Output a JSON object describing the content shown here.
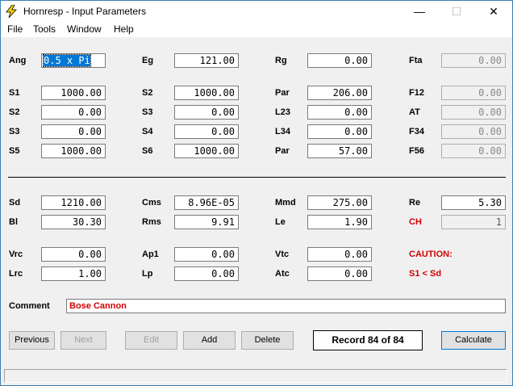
{
  "window": {
    "title": "Hornresp - Input Parameters",
    "minimize": "—",
    "maximize": "☐",
    "close": "✕"
  },
  "menu": {
    "file": "File",
    "tools": "Tools",
    "window": "Window",
    "help": "Help"
  },
  "fields": {
    "Ang": "0.5 x Pi",
    "Eg": "121.00",
    "Rg": "0.00",
    "Fta": "0.00",
    "S1": "1000.00",
    "S2a": "1000.00",
    "Par1": "206.00",
    "F12": "0.00",
    "S2": "0.00",
    "S3a": "0.00",
    "L23": "0.00",
    "AT": "0.00",
    "S3": "0.00",
    "S4": "0.00",
    "L34": "0.00",
    "F34": "0.00",
    "S5": "1000.00",
    "S6": "1000.00",
    "Par2": "57.00",
    "F56": "0.00",
    "Sd": "1210.00",
    "Cms": "8.96E-05",
    "Mmd": "275.00",
    "Re": "5.30",
    "Bl": "30.30",
    "Rms": "9.91",
    "Le": "1.90",
    "CH": "1",
    "Vrc": "0.00",
    "Ap1": "0.00",
    "Vtc": "0.00",
    "Lrc": "1.00",
    "Lp": "0.00",
    "Atc": "0.00"
  },
  "labels": {
    "Ang": "Ang",
    "Eg": "Eg",
    "Rg": "Rg",
    "Fta": "Fta",
    "S1": "S1",
    "S2a": "S2",
    "Par1": "Par",
    "F12": "F12",
    "S2": "S2",
    "S3a": "S3",
    "L23": "L23",
    "AT": "AT",
    "S3": "S3",
    "S4": "S4",
    "L34": "L34",
    "F34": "F34",
    "S5": "S5",
    "S6": "S6",
    "Par2": "Par",
    "F56": "F56",
    "Sd": "Sd",
    "Cms": "Cms",
    "Mmd": "Mmd",
    "Re": "Re",
    "Bl": "Bl",
    "Rms": "Rms",
    "Le": "Le",
    "CH": "CH",
    "Vrc": "Vrc",
    "Ap1": "Ap1",
    "Vtc": "Vtc",
    "Lrc": "Lrc",
    "Lp": "Lp",
    "Atc": "Atc",
    "Comment": "Comment"
  },
  "caution": {
    "title": "CAUTION:",
    "message": "S1 < Sd"
  },
  "comment": "Bose Cannon",
  "buttons": {
    "previous": "Previous",
    "next": "Next",
    "edit": "Edit",
    "add": "Add",
    "delete": "Delete",
    "calculate": "Calculate"
  },
  "record": "Record 84 of 84",
  "colors": {
    "accent": "#0078d7",
    "warning": "#d40000",
    "title_icon": "#f5d000"
  }
}
